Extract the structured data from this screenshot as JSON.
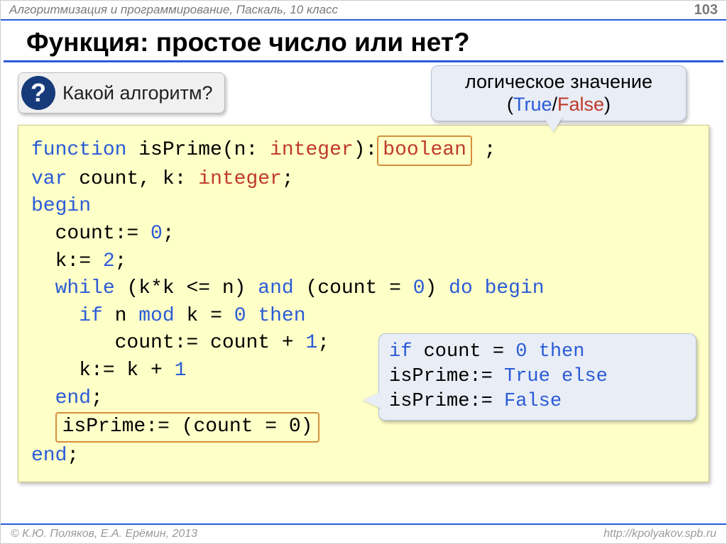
{
  "header": {
    "breadcrumb": "Алгоритмизация и программирование, Паскаль, 10 класс",
    "page": "103"
  },
  "title": "Функция: простое число или нет?",
  "question": {
    "mark": "?",
    "text": "Какой алгоритм?"
  },
  "callout_top": {
    "line1": "логическое значение",
    "paren_open": "(",
    "true": "True",
    "slash": "/",
    "false": "False",
    "paren_close": ")"
  },
  "code": {
    "l1a": "function",
    "l1b": " isPrime(n: ",
    "l1c": "integer",
    "l1d": "):",
    "l1box": "boolean",
    "l1e": " ;",
    "l2a": "var",
    "l2b": " count, k: ",
    "l2c": "integer",
    "l2d": ";",
    "l3": "begin",
    "l4a": "  count:= ",
    "l4b": "0",
    "l4c": ";",
    "l5a": "  k:= ",
    "l5b": "2",
    "l5c": ";",
    "l6a": "  ",
    "l6b": "while",
    "l6c": " (k*k <= n) ",
    "l6d": "and",
    "l6e": " (count = ",
    "l6f": "0",
    "l6g": ") ",
    "l6h": "do",
    "l6i": " ",
    "l6j": "begin",
    "l7a": "    ",
    "l7b": "if",
    "l7c": " n ",
    "l7d": "mod",
    "l7e": " k = ",
    "l7f": "0",
    "l7g": " ",
    "l7h": "then",
    "l8a": "       count:= count + ",
    "l8b": "1",
    "l8c": ";",
    "l9a": "    k:= k + ",
    "l9b": "1",
    "l10a": "  ",
    "l10b": "end",
    "l10c": ";",
    "l11a": "  ",
    "l11box": "isPrime:= (count = 0)",
    "l12a": "end",
    "l12b": ";"
  },
  "callout_right": {
    "r1a": "if",
    "r1b": " count = ",
    "r1c": "0",
    "r1d": " ",
    "r1e": "then",
    "r2a": "     isPrime:= ",
    "r2b": "True",
    "r3a": "else",
    "r3b": " isPrime:= ",
    "r3c": "False"
  },
  "footer": {
    "left": "© К.Ю. Поляков, Е.А. Ерёмин, 2013",
    "right": "http://kpolyakov.spb.ru"
  }
}
